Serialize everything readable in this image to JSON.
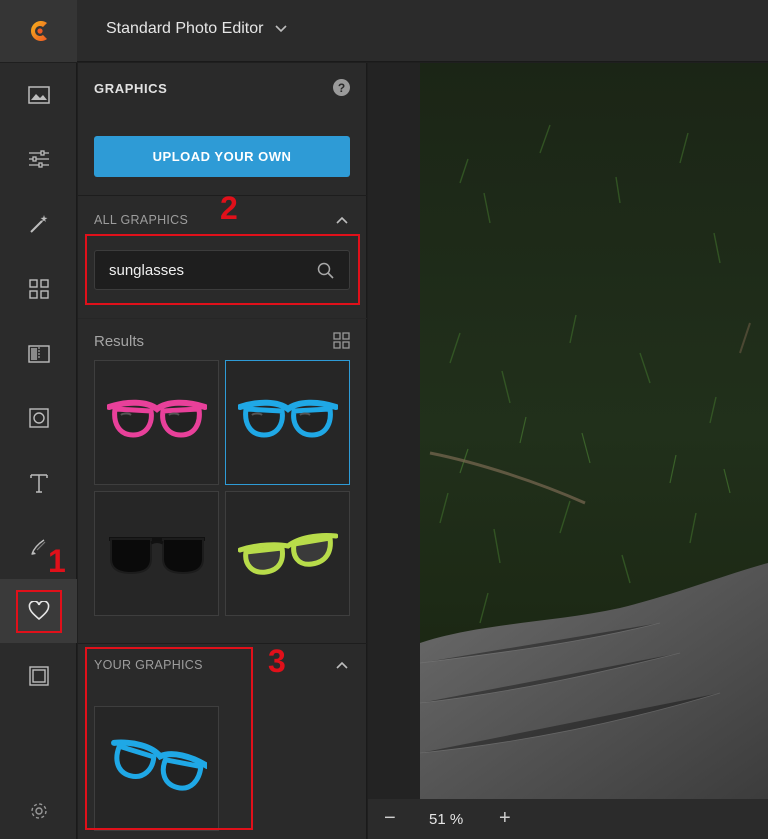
{
  "header": {
    "app_title": "Standard Photo Editor",
    "logo_icon": "editor-logo-icon",
    "title_dropdown_icon": "chevron-down-icon"
  },
  "rail": {
    "items": [
      {
        "icon": "image-icon",
        "active": false
      },
      {
        "icon": "sliders-icon",
        "active": false
      },
      {
        "icon": "magic-wand-icon",
        "active": false
      },
      {
        "icon": "grid-icon",
        "active": false
      },
      {
        "icon": "texture-icon",
        "active": false
      },
      {
        "icon": "frame-icon",
        "active": false
      },
      {
        "icon": "text-icon",
        "active": false
      },
      {
        "icon": "brush-icon",
        "active": false
      },
      {
        "icon": "heart-icon",
        "active": true
      },
      {
        "icon": "border-icon",
        "active": false
      },
      {
        "icon": "gear-icon",
        "active": false
      }
    ]
  },
  "panel": {
    "title": "GRAPHICS",
    "help_label": "?",
    "upload_label": "UPLOAD YOUR OWN",
    "all_graphics_label": "ALL GRAPHICS",
    "search": {
      "value": "sunglasses",
      "placeholder": ""
    },
    "results_label": "Results",
    "results": [
      {
        "name": "pink-sunglasses",
        "frame_color": "#e8409a",
        "selected": false
      },
      {
        "name": "blue-sunglasses",
        "frame_color": "#1fa8e6",
        "selected": true
      },
      {
        "name": "black-sunglasses",
        "frame_color": "#111111",
        "selected": false
      },
      {
        "name": "lime-glasses",
        "frame_color": "#b8dc4a",
        "selected": false
      }
    ],
    "your_graphics_label": "YOUR GRAPHICS",
    "your_graphics": [
      {
        "name": "blue-sunglasses",
        "frame_color": "#1fa8e6"
      }
    ]
  },
  "annotations": {
    "numbers": [
      "1",
      "2",
      "3"
    ],
    "color": "#e0101a"
  },
  "zoom": {
    "minus_label": "−",
    "value": "51 %",
    "plus_label": "+"
  },
  "colors": {
    "accent": "#2e9bd6",
    "background": "#2a2a2a"
  }
}
